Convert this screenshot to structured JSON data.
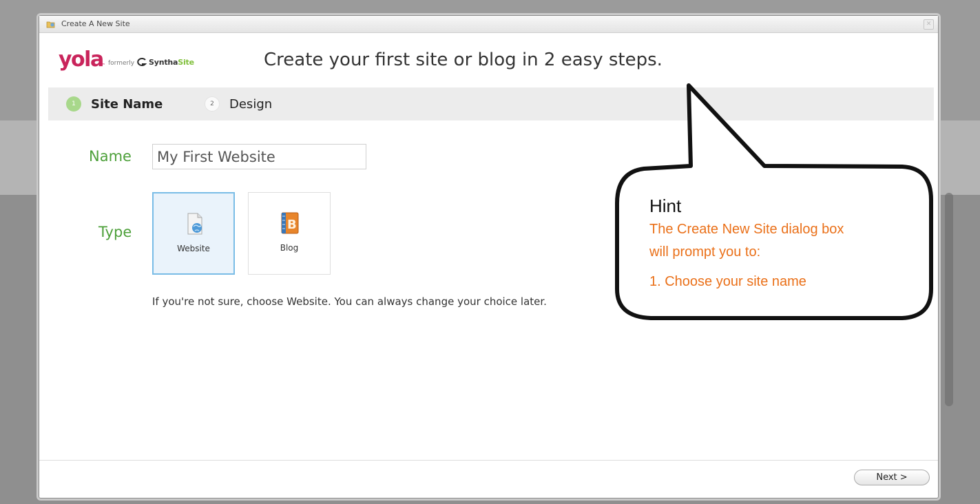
{
  "window": {
    "title": "Create A New Site",
    "close_glyph": "✕"
  },
  "header": {
    "logo": {
      "yola": "yola",
      "tm": "™",
      "formerly": "formerly",
      "synth": "Syntha",
      "site": "Site"
    },
    "headline": "Create your first site or blog in 2 easy steps."
  },
  "steps": [
    {
      "num": "1",
      "label": "Site Name",
      "state": "active"
    },
    {
      "num": "2",
      "label": "Design",
      "state": "inactive"
    }
  ],
  "form": {
    "name_label": "Name",
    "name_value": "My First Website",
    "type_label": "Type",
    "types": [
      {
        "label": "Website",
        "icon": "website-page-globe-icon",
        "selected": true
      },
      {
        "label": "Blog",
        "icon": "blog-book-icon",
        "selected": false
      }
    ],
    "help_text": "If you're not sure, choose Website. You can always change your choice later."
  },
  "footer": {
    "next_label": "Next >"
  },
  "hint": {
    "title": "Hint",
    "lines": [
      "The Create New Site dialog box",
      "will prompt you to:",
      "1. Choose your site name"
    ]
  },
  "colors": {
    "yola_brand": "#c9245b",
    "label_green": "#4da03a",
    "hint_orange": "#ea7019",
    "selected_card_border": "#79bce6"
  }
}
